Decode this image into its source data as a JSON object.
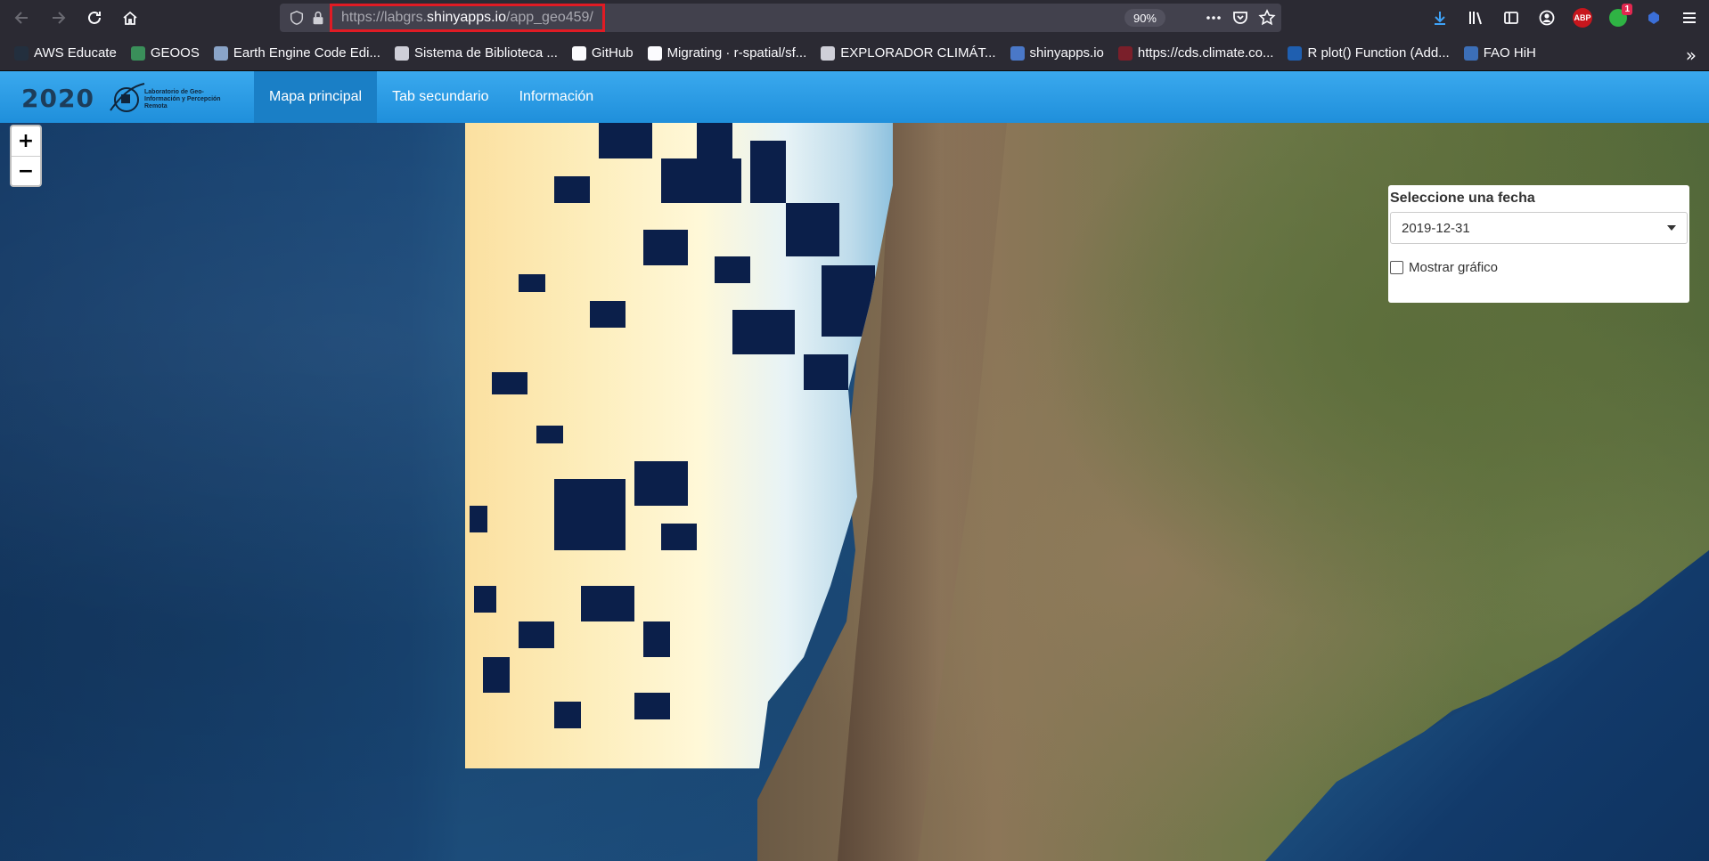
{
  "browser": {
    "url_prefix": "https://labgrs.",
    "url_host": "shinyapps.io",
    "url_suffix": "/app_geo459/",
    "zoom": "90%",
    "badge_count": "1",
    "abp_label": "ABP",
    "overflow_label": "»"
  },
  "bookmarks": [
    {
      "label": "AWS Educate",
      "color": "#232f3e"
    },
    {
      "label": "GEOOS",
      "color": "#3a8f5a"
    },
    {
      "label": "Earth Engine Code Edi...",
      "color": "#8aa4c8"
    },
    {
      "label": "Sistema de Biblioteca ...",
      "color": "#cfcfd8"
    },
    {
      "label": "GitHub",
      "color": "#fbfbfe"
    },
    {
      "label": "Migrating · r-spatial/sf...",
      "color": "#fbfbfe"
    },
    {
      "label": "EXPLORADOR CLIMÁT...",
      "color": "#cfcfd8"
    },
    {
      "label": "shinyapps.io",
      "color": "#4a78c8"
    },
    {
      "label": "https://cds.climate.co...",
      "color": "#7a1f2a"
    },
    {
      "label": "R plot() Function (Add...",
      "color": "#1f5fb0"
    },
    {
      "label": "FAO HiH",
      "color": "#3c6fb8"
    }
  ],
  "app": {
    "brand_year": "2020",
    "brand_lab": "Laboratorio de Geo-Información y Percepción Remota",
    "tabs": [
      "Mapa principal",
      "Tab secundario",
      "Información"
    ]
  },
  "map": {
    "zoom_in": "+",
    "zoom_out": "−"
  },
  "panel": {
    "label": "Seleccione una fecha",
    "date_value": "2019-12-31",
    "checkbox_label": "Mostrar gráfico"
  }
}
